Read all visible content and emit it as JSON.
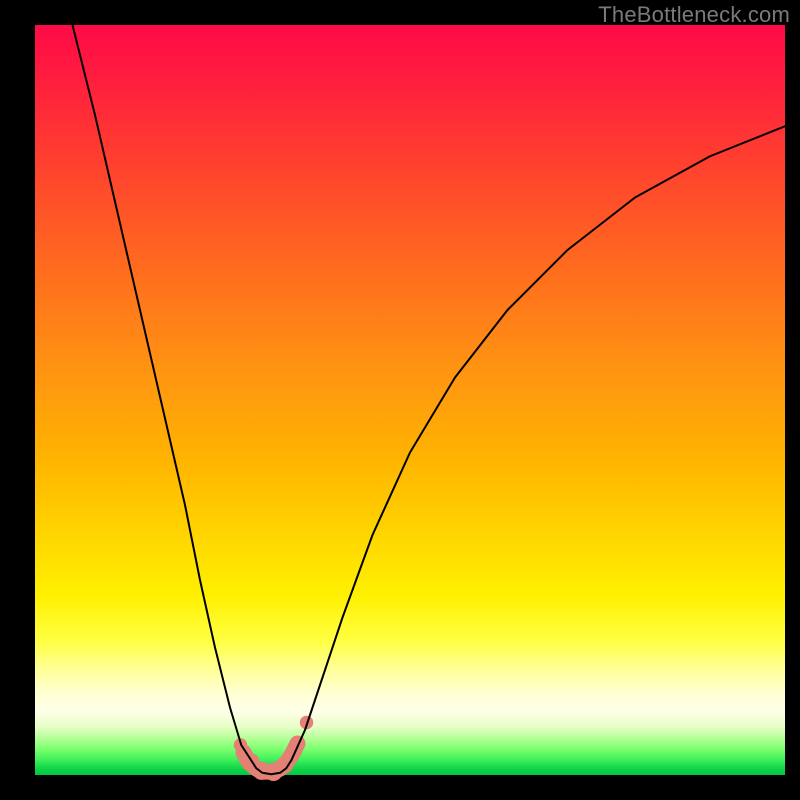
{
  "watermark": "TheBottleneck.com",
  "chart_data": {
    "type": "line",
    "title": "",
    "xlabel": "",
    "ylabel": "",
    "xlim": [
      0,
      100
    ],
    "ylim": [
      0,
      100
    ],
    "grid": false,
    "legend": false,
    "series": [
      {
        "name": "left-branch",
        "x": [
          5,
          8,
          11,
          14,
          17,
          20,
          22,
          24,
          26,
          27.5,
          28.8
        ],
        "y": [
          100,
          88,
          75,
          62,
          49,
          36,
          26,
          17,
          9,
          4,
          2
        ]
      },
      {
        "name": "right-branch",
        "x": [
          34.2,
          36,
          38,
          41,
          45,
          50,
          56,
          63,
          71,
          80,
          90,
          100
        ],
        "y": [
          2,
          6,
          12,
          21,
          32,
          43,
          53,
          62,
          70,
          77,
          82.5,
          86.5
        ]
      },
      {
        "name": "bottom-u",
        "x": [
          28.8,
          29.5,
          30.3,
          31.5,
          32.7,
          33.5,
          34.2
        ],
        "y": [
          2,
          0.9,
          0.3,
          0.1,
          0.3,
          0.9,
          2
        ]
      }
    ],
    "markers": {
      "name": "salmon-dots",
      "color": "#e58074",
      "points": [
        {
          "x": 27.4,
          "y": 4.0,
          "r": 0.9
        },
        {
          "x": 28.8,
          "y": 1.8,
          "r": 1.1
        },
        {
          "x": 30.2,
          "y": 0.55,
          "r": 1.2
        },
        {
          "x": 31.8,
          "y": 0.4,
          "r": 1.2
        },
        {
          "x": 33.3,
          "y": 1.3,
          "r": 1.1
        },
        {
          "x": 34.6,
          "y": 3.2,
          "r": 1.0
        },
        {
          "x": 36.2,
          "y": 7.0,
          "r": 0.9
        }
      ]
    },
    "thick_u": {
      "name": "salmon-thick-arc",
      "color": "#e58074",
      "x": [
        27.8,
        28.6,
        29.6,
        30.6,
        31.6,
        32.6,
        33.5,
        34.3,
        35.0
      ],
      "y": [
        3.0,
        1.6,
        0.8,
        0.45,
        0.45,
        0.8,
        1.6,
        2.8,
        4.2
      ]
    }
  }
}
